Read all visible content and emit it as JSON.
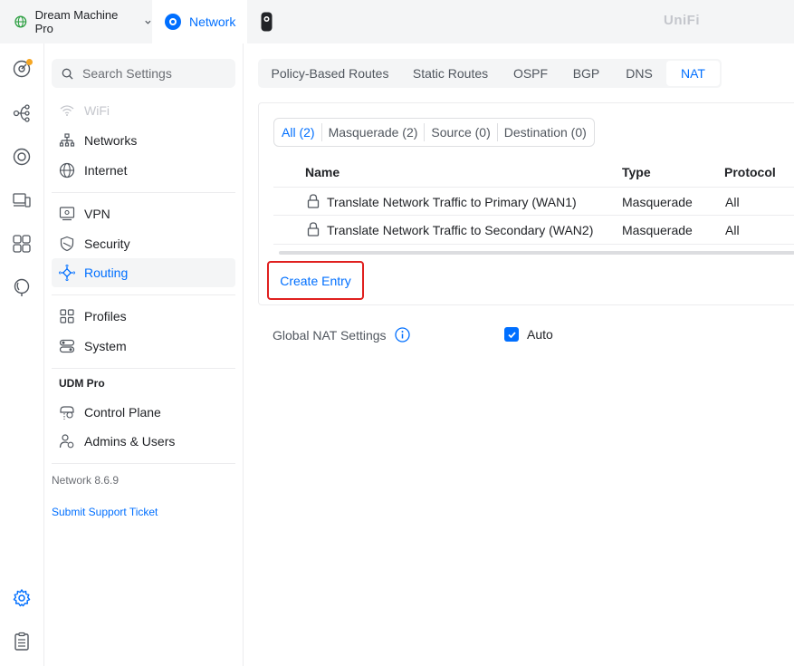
{
  "topbar": {
    "device_name": "Dream Machine Pro",
    "app_tab_label": "Network",
    "brand": "UniFi"
  },
  "search": {
    "placeholder": "Search Settings"
  },
  "nav": {
    "wifi": "WiFi",
    "networks": "Networks",
    "internet": "Internet",
    "vpn": "VPN",
    "security": "Security",
    "routing": "Routing",
    "profiles": "Profiles",
    "system": "System",
    "section_udm": "UDM Pro",
    "control_plane": "Control Plane",
    "admins_users": "Admins & Users",
    "version": "Network 8.6.9",
    "support": "Submit Support Ticket"
  },
  "tabs": [
    "Policy-Based Routes",
    "Static Routes",
    "OSPF",
    "BGP",
    "DNS",
    "NAT"
  ],
  "active_tab": "NAT",
  "filters": [
    "All (2)",
    "Masquerade (2)",
    "Source (0)",
    "Destination (0)"
  ],
  "table": {
    "columns": [
      "Name",
      "Type",
      "Protocol"
    ],
    "rows": [
      {
        "name": "Translate Network Traffic to Primary (WAN1)",
        "type": "Masquerade",
        "protocol": "All"
      },
      {
        "name": "Translate Network Traffic to Secondary (WAN2)",
        "type": "Masquerade",
        "protocol": "All"
      }
    ]
  },
  "create_entry_label": "Create Entry",
  "global_nat": {
    "label": "Global NAT Settings",
    "auto_label": "Auto",
    "auto_checked": true
  },
  "colors": {
    "accent": "#006fff",
    "highlight_border": "#e0201f",
    "notification_dot": "#f5a623"
  }
}
